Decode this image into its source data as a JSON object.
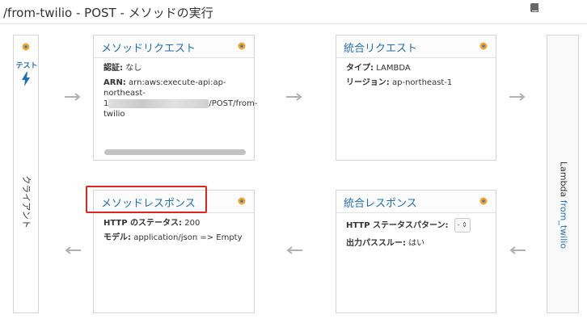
{
  "header": {
    "title": "/from-twilio - POST - メソッドの実行"
  },
  "client": {
    "test_label": "テスト",
    "label": "クライアント"
  },
  "method_request": {
    "title": "メソッドリクエスト",
    "auth_label": "認証:",
    "auth_value": "なし",
    "arn_label": "ARN:",
    "arn_line1": "arn:aws:execute-api:ap-",
    "arn_line2": "northeast-",
    "arn_line3_prefix": "1",
    "arn_line3_suffix": "/POST/from-",
    "arn_line4": "twilio"
  },
  "integration_request": {
    "title": "統合リクエスト",
    "type_label": "タイプ:",
    "type_value": "LAMBDA",
    "region_label": "リージョン:",
    "region_value": "ap-northeast-1"
  },
  "lambda": {
    "label": "Lambda",
    "function_name": "from_twilio"
  },
  "method_response": {
    "title": "メソッドレスポンス",
    "status_label": "HTTP のステータス:",
    "status_value": "200",
    "model_label": "モデル:",
    "model_value": "application/json => Empty"
  },
  "integration_response": {
    "title": "統合レスポンス",
    "pattern_label": "HTTP ステータスパターン:",
    "pattern_value": "-",
    "passthrough_label": "出力パススルー:",
    "passthrough_value": "はい"
  },
  "colors": {
    "link": "#1f6fb5",
    "highlight": "#e0251b",
    "status_dot": "#f5a623"
  },
  "icons": {
    "book": "book-icon",
    "status": "status-dot-icon",
    "bolt": "lightning-bolt-icon",
    "arrow_right": "arrow-right-icon",
    "arrow_left": "arrow-left-icon"
  }
}
